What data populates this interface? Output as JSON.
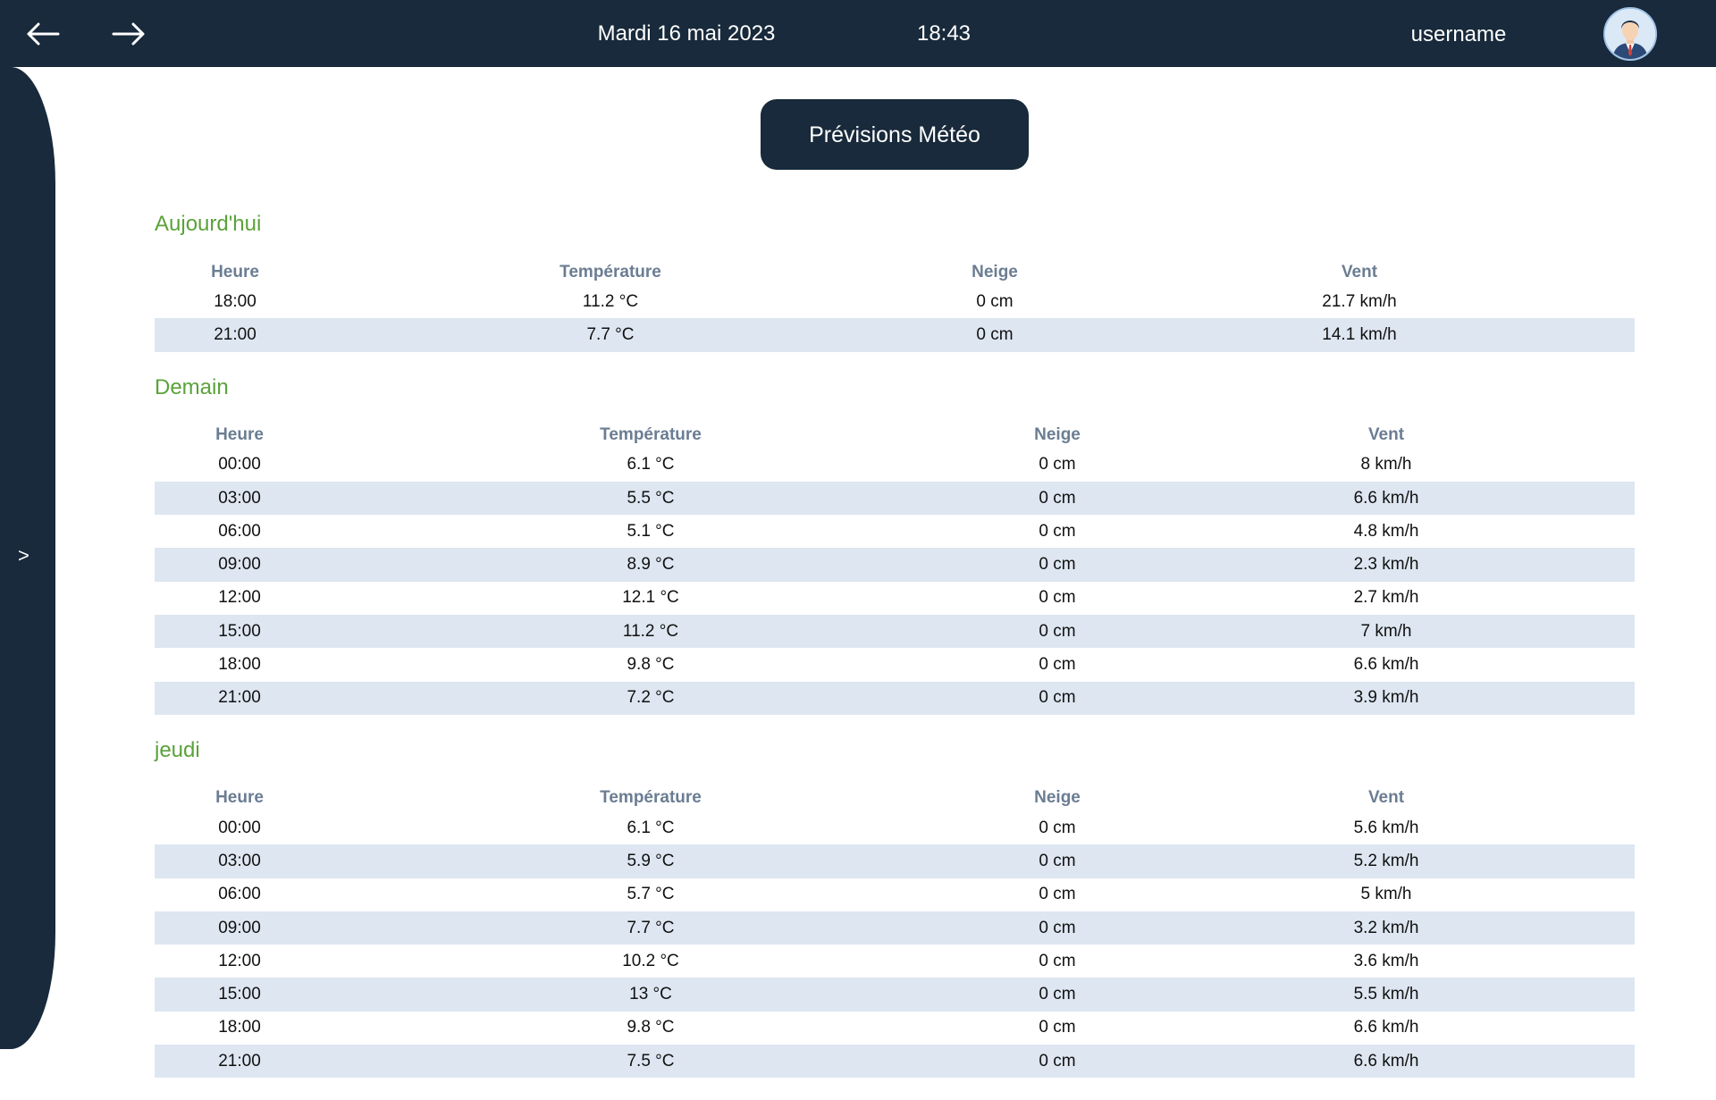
{
  "header": {
    "date": "Mardi 16 mai 2023",
    "time": "18:43",
    "username": "username",
    "back_icon": "arrow-left-icon",
    "forward_icon": "arrow-right-icon",
    "avatar_icon": "user-avatar-icon",
    "background_color": "#182a3b"
  },
  "sidebar": {
    "toggle_label": ">"
  },
  "page": {
    "title": "Prévisions Météo"
  },
  "columns": [
    "Heure",
    "Température",
    "Neige",
    "Vent"
  ],
  "colors": {
    "day_title": "#5aa23a",
    "column_header": "#6b7d93",
    "row_stripe": "#dde6f1"
  },
  "days": [
    {
      "title": "Aujourd'hui",
      "rows": [
        [
          "18:00",
          "11.2 °C",
          "0 cm",
          "21.7 km/h"
        ],
        [
          "21:00",
          "7.7 °C",
          "0 cm",
          "14.1 km/h"
        ]
      ]
    },
    {
      "title": "Demain",
      "rows": [
        [
          "00:00",
          "6.1 °C",
          "0 cm",
          "8 km/h"
        ],
        [
          "03:00",
          "5.5 °C",
          "0 cm",
          "6.6 km/h"
        ],
        [
          "06:00",
          "5.1 °C",
          "0 cm",
          "4.8 km/h"
        ],
        [
          "09:00",
          "8.9 °C",
          "0 cm",
          "2.3 km/h"
        ],
        [
          "12:00",
          "12.1 °C",
          "0 cm",
          "2.7 km/h"
        ],
        [
          "15:00",
          "11.2 °C",
          "0 cm",
          "7 km/h"
        ],
        [
          "18:00",
          "9.8 °C",
          "0 cm",
          "6.6 km/h"
        ],
        [
          "21:00",
          "7.2 °C",
          "0 cm",
          "3.9 km/h"
        ]
      ]
    },
    {
      "title": "jeudi",
      "rows": [
        [
          "00:00",
          "6.1 °C",
          "0 cm",
          "5.6 km/h"
        ],
        [
          "03:00",
          "5.9 °C",
          "0 cm",
          "5.2 km/h"
        ],
        [
          "06:00",
          "5.7 °C",
          "0 cm",
          "5 km/h"
        ],
        [
          "09:00",
          "7.7 °C",
          "0 cm",
          "3.2 km/h"
        ],
        [
          "12:00",
          "10.2 °C",
          "0 cm",
          "3.6 km/h"
        ],
        [
          "15:00",
          "13 °C",
          "0 cm",
          "5.5 km/h"
        ],
        [
          "18:00",
          "9.8 °C",
          "0 cm",
          "6.6 km/h"
        ],
        [
          "21:00",
          "7.5 °C",
          "0 cm",
          "6.6 km/h"
        ]
      ]
    }
  ]
}
